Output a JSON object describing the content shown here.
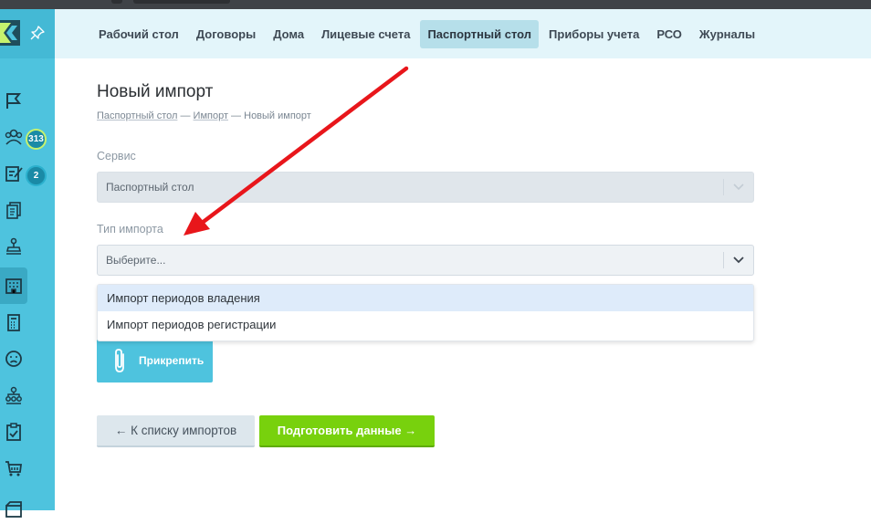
{
  "nav": {
    "items": [
      {
        "label": "Рабочий стол"
      },
      {
        "label": "Договоры"
      },
      {
        "label": "Дома"
      },
      {
        "label": "Лицевые счета"
      },
      {
        "label": "Паспортный стол",
        "active": true
      },
      {
        "label": "Приборы учета"
      },
      {
        "label": "РСО"
      },
      {
        "label": "Журналы"
      }
    ]
  },
  "sidebar": {
    "badges": {
      "team": "313",
      "tasks": "2"
    }
  },
  "page": {
    "title": "Новый импорт",
    "breadcrumb": {
      "link1": "Паспортный стол",
      "sep1": " — ",
      "link2": "Импорт",
      "sep2": " — ",
      "current": "Новый импорт"
    }
  },
  "form": {
    "service_label": "Сервис",
    "service_value": "Паспортный стол",
    "import_type_label": "Тип импорта",
    "import_type_placeholder": "Выберите...",
    "import_type_options": [
      "Импорт периодов владения",
      "Импорт периодов регистрации"
    ],
    "attach_label": "Прикрепить"
  },
  "actions": {
    "back_label": "← К списку импортов",
    "prepare_label": "Подготовить данные →"
  },
  "colors": {
    "sidebar": "#4ec3de",
    "header": "#e3f5fa",
    "primary_green": "#78d10d",
    "annotation_arrow": "#e8161b"
  }
}
